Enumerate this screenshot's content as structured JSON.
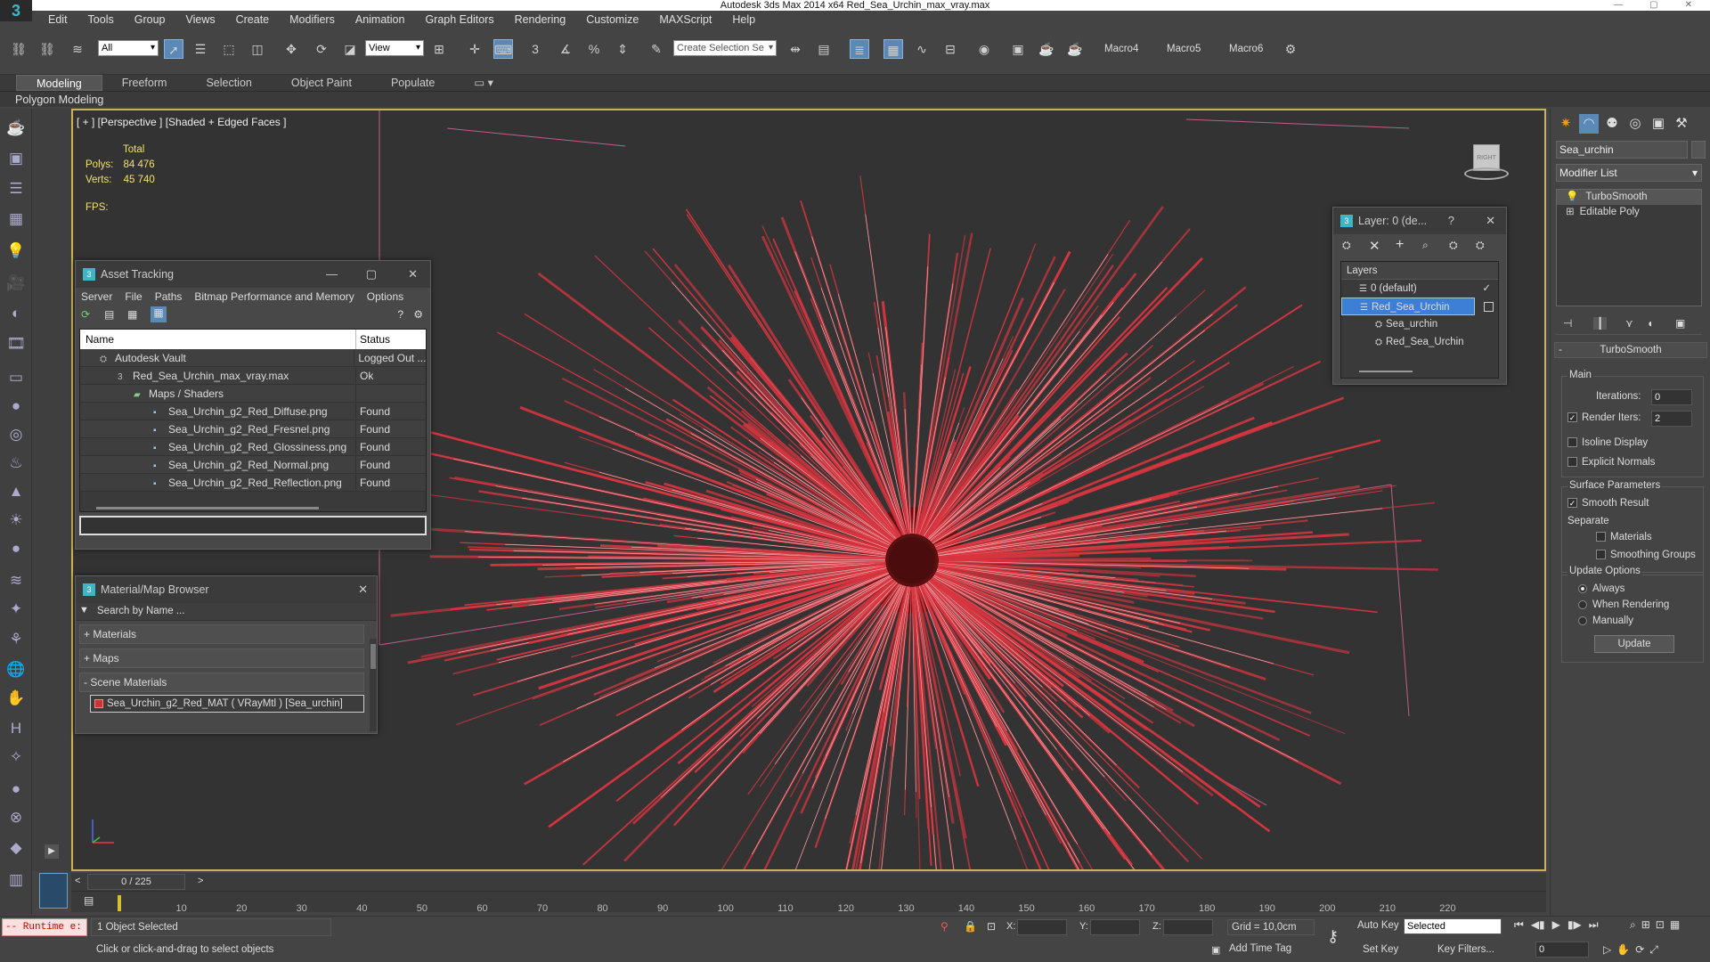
{
  "app": {
    "title": "Autodesk 3ds Max 2014 x64  Red_Sea_Urchin_max_vray.max",
    "logo": "3"
  },
  "menu": [
    "Edit",
    "Tools",
    "Group",
    "Views",
    "Create",
    "Modifiers",
    "Animation",
    "Graph Editors",
    "Rendering",
    "Customize",
    "MAXScript",
    "Help"
  ],
  "toolbar": {
    "filter_value": "All",
    "refcoord_value": "View",
    "selset_placeholder": "Create Selection Se",
    "snap_label": "3",
    "macros": [
      "Macro4",
      "Macro5",
      "Macro6"
    ]
  },
  "ribbon": {
    "tabs": [
      "Modeling",
      "Freeform",
      "Selection",
      "Object Paint",
      "Populate"
    ],
    "active": "Modeling",
    "sub_label": "Polygon Modeling"
  },
  "viewport": {
    "label": "[ + ] [Perspective ] [Shaded + Edged Faces ]",
    "stats_header": "Total",
    "polys_label": "Polys:",
    "polys_value": "84 476",
    "verts_label": "Verts:",
    "verts_value": "45 740",
    "fps_label": "FPS:",
    "viewcube_label": "RIGHT"
  },
  "asset_tracking": {
    "title": "Asset Tracking",
    "menu": [
      "Server",
      "File",
      "Paths",
      "Bitmap Performance and Memory",
      "Options"
    ],
    "columns": [
      "Name",
      "Status"
    ],
    "rows": [
      {
        "name": "Autodesk Vault",
        "status": "Logged Out ..."
      },
      {
        "name": "Red_Sea_Urchin_max_vray.max",
        "status": "Ok"
      },
      {
        "name": "Maps / Shaders",
        "status": ""
      },
      {
        "name": "Sea_Urchin_g2_Red_Diffuse.png",
        "status": "Found"
      },
      {
        "name": "Sea_Urchin_g2_Red_Fresnel.png",
        "status": "Found"
      },
      {
        "name": "Sea_Urchin_g2_Red_Glossiness.png",
        "status": "Found"
      },
      {
        "name": "Sea_Urchin_g2_Red_Normal.png",
        "status": "Found"
      },
      {
        "name": "Sea_Urchin_g2_Red_Reflection.png",
        "status": "Found"
      }
    ]
  },
  "material_browser": {
    "title": "Material/Map Browser",
    "search_placeholder": "Search by Name ...",
    "sections": [
      "+ Materials",
      "+ Maps",
      "- Scene Materials"
    ],
    "scene_material": "Sea_Urchin_g2_Red_MAT ( VRayMtl ) [Sea_urchin]"
  },
  "layer_window": {
    "title": "Layer: 0 (de...",
    "help": "?",
    "header": "Layers",
    "items": [
      {
        "label": "0 (default)",
        "selected": false
      },
      {
        "label": "Red_Sea_Urchin",
        "selected": true
      },
      {
        "label": "Sea_urchin",
        "selected": false
      },
      {
        "label": "Red_Sea_Urchin",
        "selected": false
      }
    ]
  },
  "command_panel": {
    "object_name": "Sea_urchin",
    "modifier_list": "Modifier List",
    "stack": [
      "TurboSmooth",
      "Editable Poly"
    ],
    "rollout": "TurboSmooth",
    "main_label": "Main",
    "iterations_label": "Iterations:",
    "iterations_value": "0",
    "render_iters_label": "Render Iters:",
    "render_iters_value": "2",
    "isoline": "Isoline Display",
    "explicit_normals": "Explicit Normals",
    "surface_params": "Surface Parameters",
    "smooth_result": "Smooth Result",
    "separate": "Separate",
    "materials": "Materials",
    "smoothing_groups": "Smoothing Groups",
    "update_options": "Update Options",
    "always": "Always",
    "when_rendering": "When Rendering",
    "manually": "Manually",
    "update_button": "Update"
  },
  "timeline": {
    "frame": "0 / 225",
    "ticks": [
      "10",
      "20",
      "30",
      "40",
      "50",
      "60",
      "70",
      "80",
      "90",
      "100",
      "110",
      "120",
      "130",
      "140",
      "150",
      "160",
      "170",
      "180",
      "190",
      "200",
      "210",
      "220"
    ]
  },
  "status": {
    "runtime": "-- Runtime e:",
    "selected": "1 Object Selected",
    "prompt": "Click or click-and-drag to select objects",
    "x_label": "X:",
    "y_label": "Y:",
    "z_label": "Z:",
    "grid": "Grid = 10,0cm",
    "add_time_tag": "Add Time Tag",
    "auto_key": "Auto Key",
    "set_key": "Set Key",
    "key_mode": "Selected",
    "key_filters": "Key Filters...",
    "frame_value": "0"
  },
  "colors": {
    "spine": "#d8353f",
    "viewport_border": "#c9b35a",
    "accent": "#3fb6c8",
    "selection": "#3d7fd6"
  }
}
